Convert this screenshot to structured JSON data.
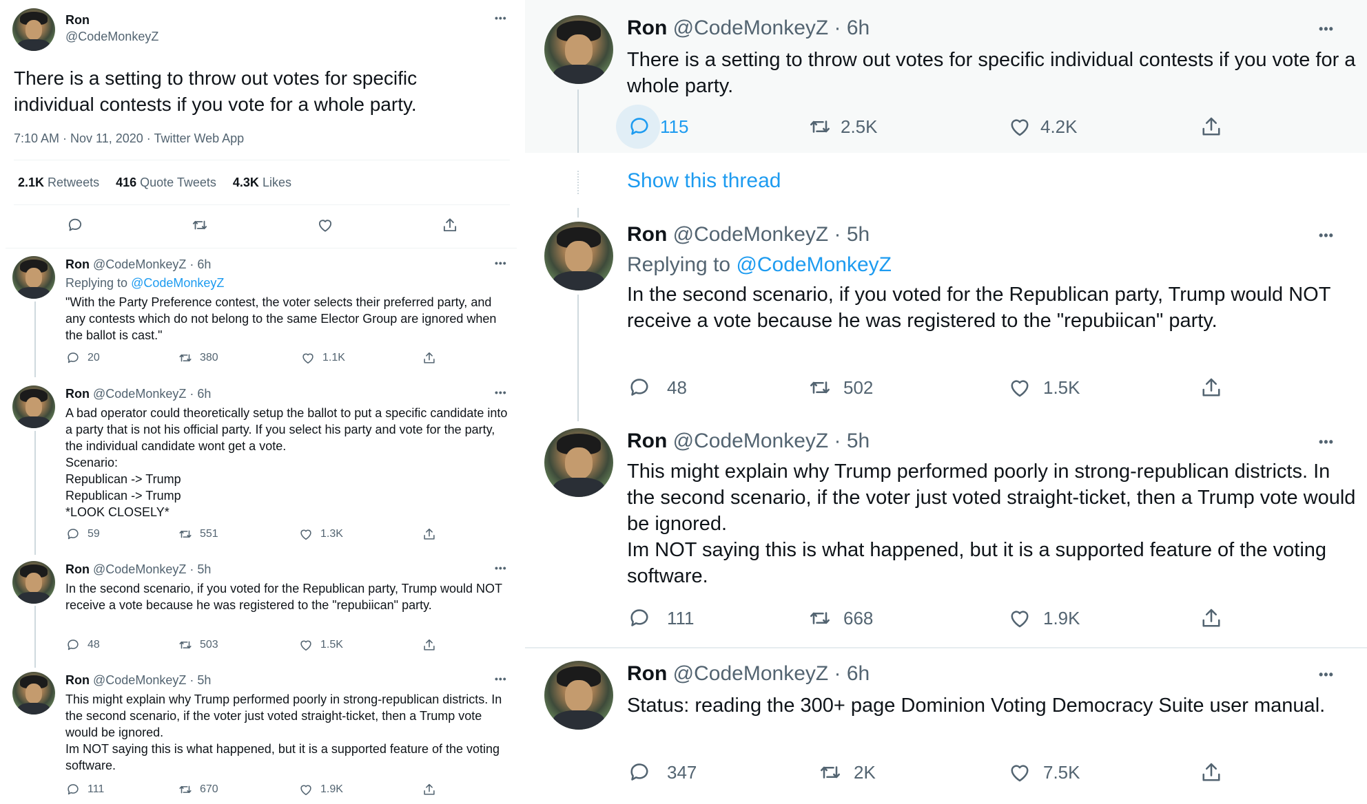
{
  "main": {
    "name": "Ron",
    "handle": "@CodeMonkeyZ",
    "text": "There is a setting to throw out votes for specific individual contests if you vote for a whole party.",
    "meta": "7:10 AM · Nov 11, 2020 · Twitter Web App",
    "retweets_num": "2.1K",
    "retweets_label": "Retweets",
    "quotes_num": "416",
    "quotes_label": "Quote Tweets",
    "likes_num": "4.3K",
    "likes_label": "Likes"
  },
  "left_replies": [
    {
      "name": "Ron",
      "handle_time": "@CodeMonkeyZ · 6h",
      "replying_prefix": "Replying to ",
      "replying_handle": "@CodeMonkeyZ",
      "text": "\"With the Party Preference contest, the voter selects their preferred party, and any contests which do not belong to the same Elector Group are ignored when the ballot is cast.\"",
      "replies": "20",
      "retweets": "380",
      "likes": "1.1K"
    },
    {
      "name": "Ron",
      "handle_time": "@CodeMonkeyZ · 6h",
      "text": "A bad operator could theoretically setup the ballot to put a specific candidate into a party that is not his official party. If you select his party and vote for the party, the individual candidate wont get a vote.\nScenario:\nRepublican -> Trump\nRepublican -> Trump\n*LOOK CLOSELY*",
      "replies": "59",
      "retweets": "551",
      "likes": "1.3K"
    },
    {
      "name": "Ron",
      "handle_time": "@CodeMonkeyZ · 5h",
      "text": "In the second scenario, if you voted for the Republican party, Trump would NOT receive a vote because he was registered to the \"repubiican\" party.",
      "replies": "48",
      "retweets": "503",
      "likes": "1.5K"
    },
    {
      "name": "Ron",
      "handle_time": "@CodeMonkeyZ · 5h",
      "text": "This might explain why Trump performed poorly in strong-republican districts. In the second scenario, if the voter just voted straight-ticket, then a Trump vote would be ignored.\nIm NOT saying this is what happened, but it is a supported feature of the voting software.",
      "replies": "111",
      "retweets": "670",
      "likes": "1.9K"
    }
  ],
  "right_tweets": [
    {
      "name": "Ron",
      "handle_time": "@CodeMonkeyZ · 6h",
      "text": "There is a setting to throw out votes for specific individual contests if you vote for a whole party.",
      "replies": "115",
      "retweets": "2.5K",
      "likes": "4.2K"
    },
    {
      "name": "Ron",
      "handle_time": "@CodeMonkeyZ · 5h",
      "replying_prefix": "Replying to ",
      "replying_handle": "@CodeMonkeyZ",
      "text": "In the second scenario, if you voted for the Republican party, Trump would NOT receive a vote because he was registered to the \"repubiican\" party.",
      "replies": "48",
      "retweets": "502",
      "likes": "1.5K"
    },
    {
      "name": "Ron",
      "handle_time": "@CodeMonkeyZ · 5h",
      "text": "This might explain why Trump performed poorly in strong-republican districts. In the second scenario, if the voter just voted straight-ticket, then a Trump vote would be ignored.\nIm NOT saying this is what happened, but it is a supported feature of the voting software.",
      "replies": "111",
      "retweets": "668",
      "likes": "1.9K"
    },
    {
      "name": "Ron",
      "handle_time": "@CodeMonkeyZ · 6h",
      "text": "Status: reading the 300+ page Dominion Voting Democracy Suite user manual.",
      "replies": "347",
      "retweets": "2K",
      "likes": "7.5K"
    }
  ],
  "show_thread": "Show this thread",
  "more_glyph": "•••",
  "colors": {
    "link": "#1d9bf0",
    "muted": "#536471",
    "highlight_bg": "#f7f9f9"
  }
}
